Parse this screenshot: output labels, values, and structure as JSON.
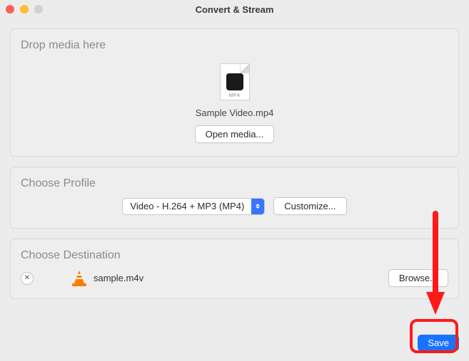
{
  "window": {
    "title": "Convert & Stream"
  },
  "drop": {
    "title": "Drop media here",
    "ext_label": "MP4",
    "file_name": "Sample Video.mp4",
    "open_label": "Open media..."
  },
  "profile": {
    "title": "Choose Profile",
    "selected": "Video - H.264 + MP3 (MP4)",
    "customize_label": "Customize..."
  },
  "destination": {
    "title": "Choose Destination",
    "file_name": "sample.m4v",
    "browse_label": "Browse...",
    "clear_symbol": "✕"
  },
  "footer": {
    "save_label": "Save"
  }
}
